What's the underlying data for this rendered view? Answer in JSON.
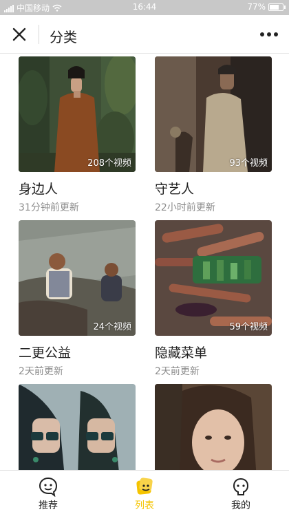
{
  "status_bar": {
    "carrier": "中国移动",
    "time": "16:44",
    "battery": "77%",
    "battery_level": 0.77
  },
  "nav": {
    "title": "分类",
    "close_icon": "close-icon",
    "more_icon": "more-dots-icon"
  },
  "categories": [
    {
      "title": "身边人",
      "updated": "31分钟前更新",
      "count": "208个视频"
    },
    {
      "title": "守艺人",
      "updated": "22小时前更新",
      "count": "93个视频"
    },
    {
      "title": "二更公益",
      "updated": "2天前更新",
      "count": "24个视频"
    },
    {
      "title": "隐藏菜单",
      "updated": "2天前更新",
      "count": "59个视频"
    },
    {
      "title": "",
      "updated": "",
      "count": ""
    },
    {
      "title": "",
      "updated": "",
      "count": ""
    }
  ],
  "tabs": [
    {
      "label": "推荐",
      "icon": "recommend-face-icon",
      "active": false
    },
    {
      "label": "列表",
      "icon": "list-face-icon",
      "active": true
    },
    {
      "label": "我的",
      "icon": "profile-face-icon",
      "active": false
    }
  ],
  "colors": {
    "accent": "#f5c400",
    "status_bar": "#c8c8c8",
    "text": "#222222",
    "subtext": "#8c8c8c"
  }
}
